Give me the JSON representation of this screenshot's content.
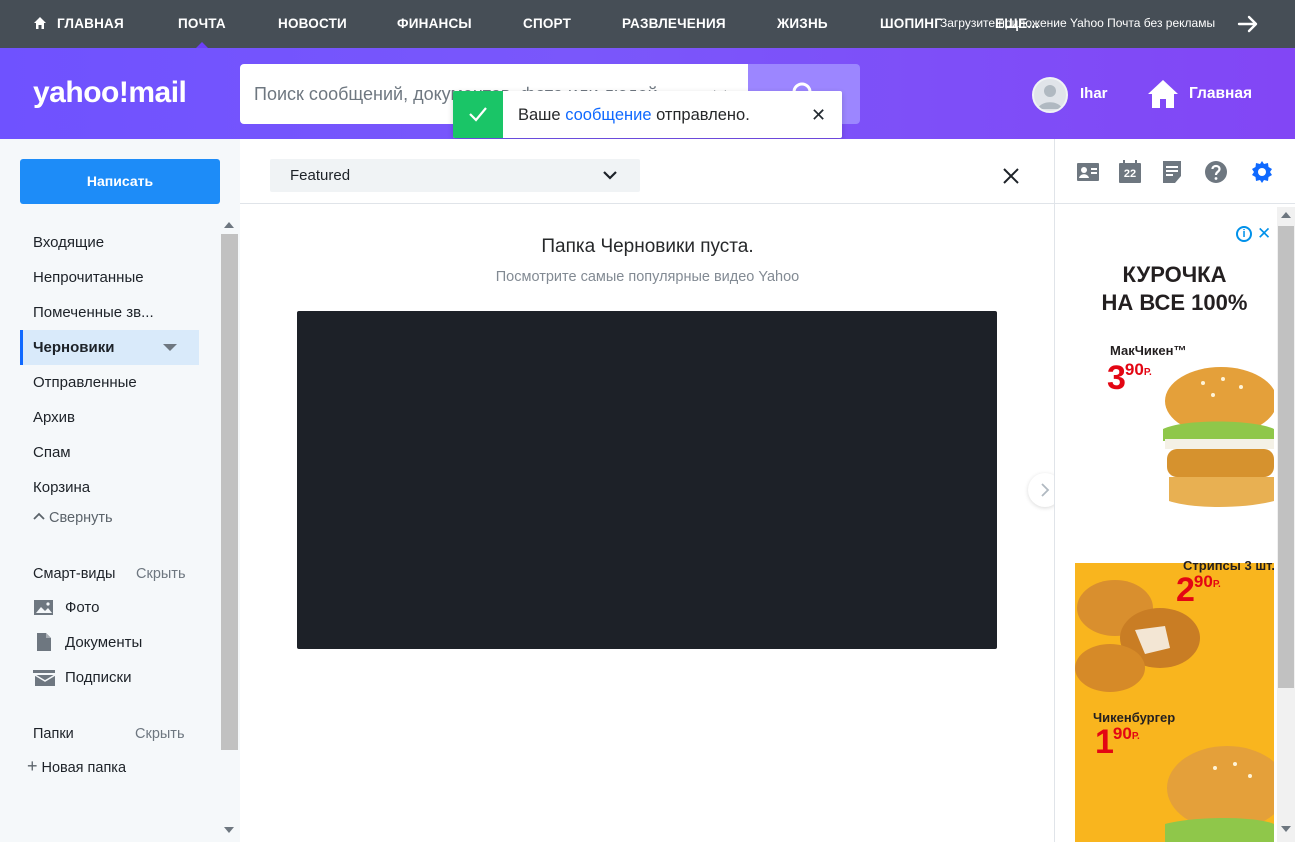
{
  "top_nav": {
    "items": [
      {
        "label": "ГЛАВНАЯ"
      },
      {
        "label": "ПОЧТА"
      },
      {
        "label": "НОВОСТИ"
      },
      {
        "label": "ФИНАНСЫ"
      },
      {
        "label": "СПОРТ"
      },
      {
        "label": "РАЗВЛЕЧЕНИЯ"
      },
      {
        "label": "ЖИЗНЬ"
      },
      {
        "label": "ШОПИНГ"
      },
      {
        "label": "ЕЩЕ..."
      }
    ],
    "active": "ПОЧТА",
    "promo_text": "Загрузите приложение Yahoo Почта без рекламы"
  },
  "header": {
    "logo": "yahoo!mail",
    "search_placeholder": "Поиск сообщений, документов, фото или людей",
    "user_name": "Ihar",
    "home_label": "Главная"
  },
  "toast": {
    "text_before": "Ваше ",
    "link": "сообщение",
    "text_after": " отправлено.",
    "close": "✕"
  },
  "sidebar": {
    "compose_label": "Написать",
    "folders": [
      {
        "label": "Входящие"
      },
      {
        "label": "Непрочитанные"
      },
      {
        "label": "Помеченные зв..."
      },
      {
        "label": "Черновики",
        "active": true
      },
      {
        "label": "Отправленные"
      },
      {
        "label": "Архив"
      },
      {
        "label": "Спам"
      },
      {
        "label": "Корзина"
      }
    ],
    "collapse_label": "Свернуть",
    "smart_views_label": "Смарт-виды",
    "smart_views_hide": "Скрыть",
    "smart_views": [
      {
        "label": "Фото",
        "icon": "photo-icon"
      },
      {
        "label": "Документы",
        "icon": "document-icon"
      },
      {
        "label": "Подписки",
        "icon": "subscriptions-icon"
      }
    ],
    "folders_label": "Папки",
    "folders_hide": "Скрыть",
    "new_folder_label": "Новая папка"
  },
  "main": {
    "dropdown_value": "Featured",
    "empty_title": "Папка Черновики пуста.",
    "empty_subtitle": "Посмотрите самые популярные видео Yahoo"
  },
  "right_rail": {
    "icons": [
      "contacts-icon",
      "calendar-icon",
      "notepad-icon",
      "help-icon",
      "settings-icon"
    ],
    "calendar_day": "22"
  },
  "ad": {
    "title_line1": "КУРОЧКА",
    "title_line2": "НА ВСЕ 100%",
    "products": [
      {
        "name": "МакЧикен™",
        "price": "3",
        "kopecks": "90",
        "currency": "Р."
      },
      {
        "name": "Стрипсы 3 шт.",
        "price": "2",
        "kopecks": "90",
        "currency": "Р."
      },
      {
        "name": "Чикенбургер",
        "price": "1",
        "kopecks": "90",
        "currency": "Р."
      }
    ]
  },
  "colors": {
    "top_nav_bg": "#464e56",
    "header_purple": "#7a57fb",
    "compose_blue": "#1d8cf8",
    "toast_green": "#1ac567",
    "link_blue": "#0f69ff",
    "settings_blue": "#0f69ff",
    "ad_yellow": "#f9b51e",
    "price_red": "#e30613"
  }
}
